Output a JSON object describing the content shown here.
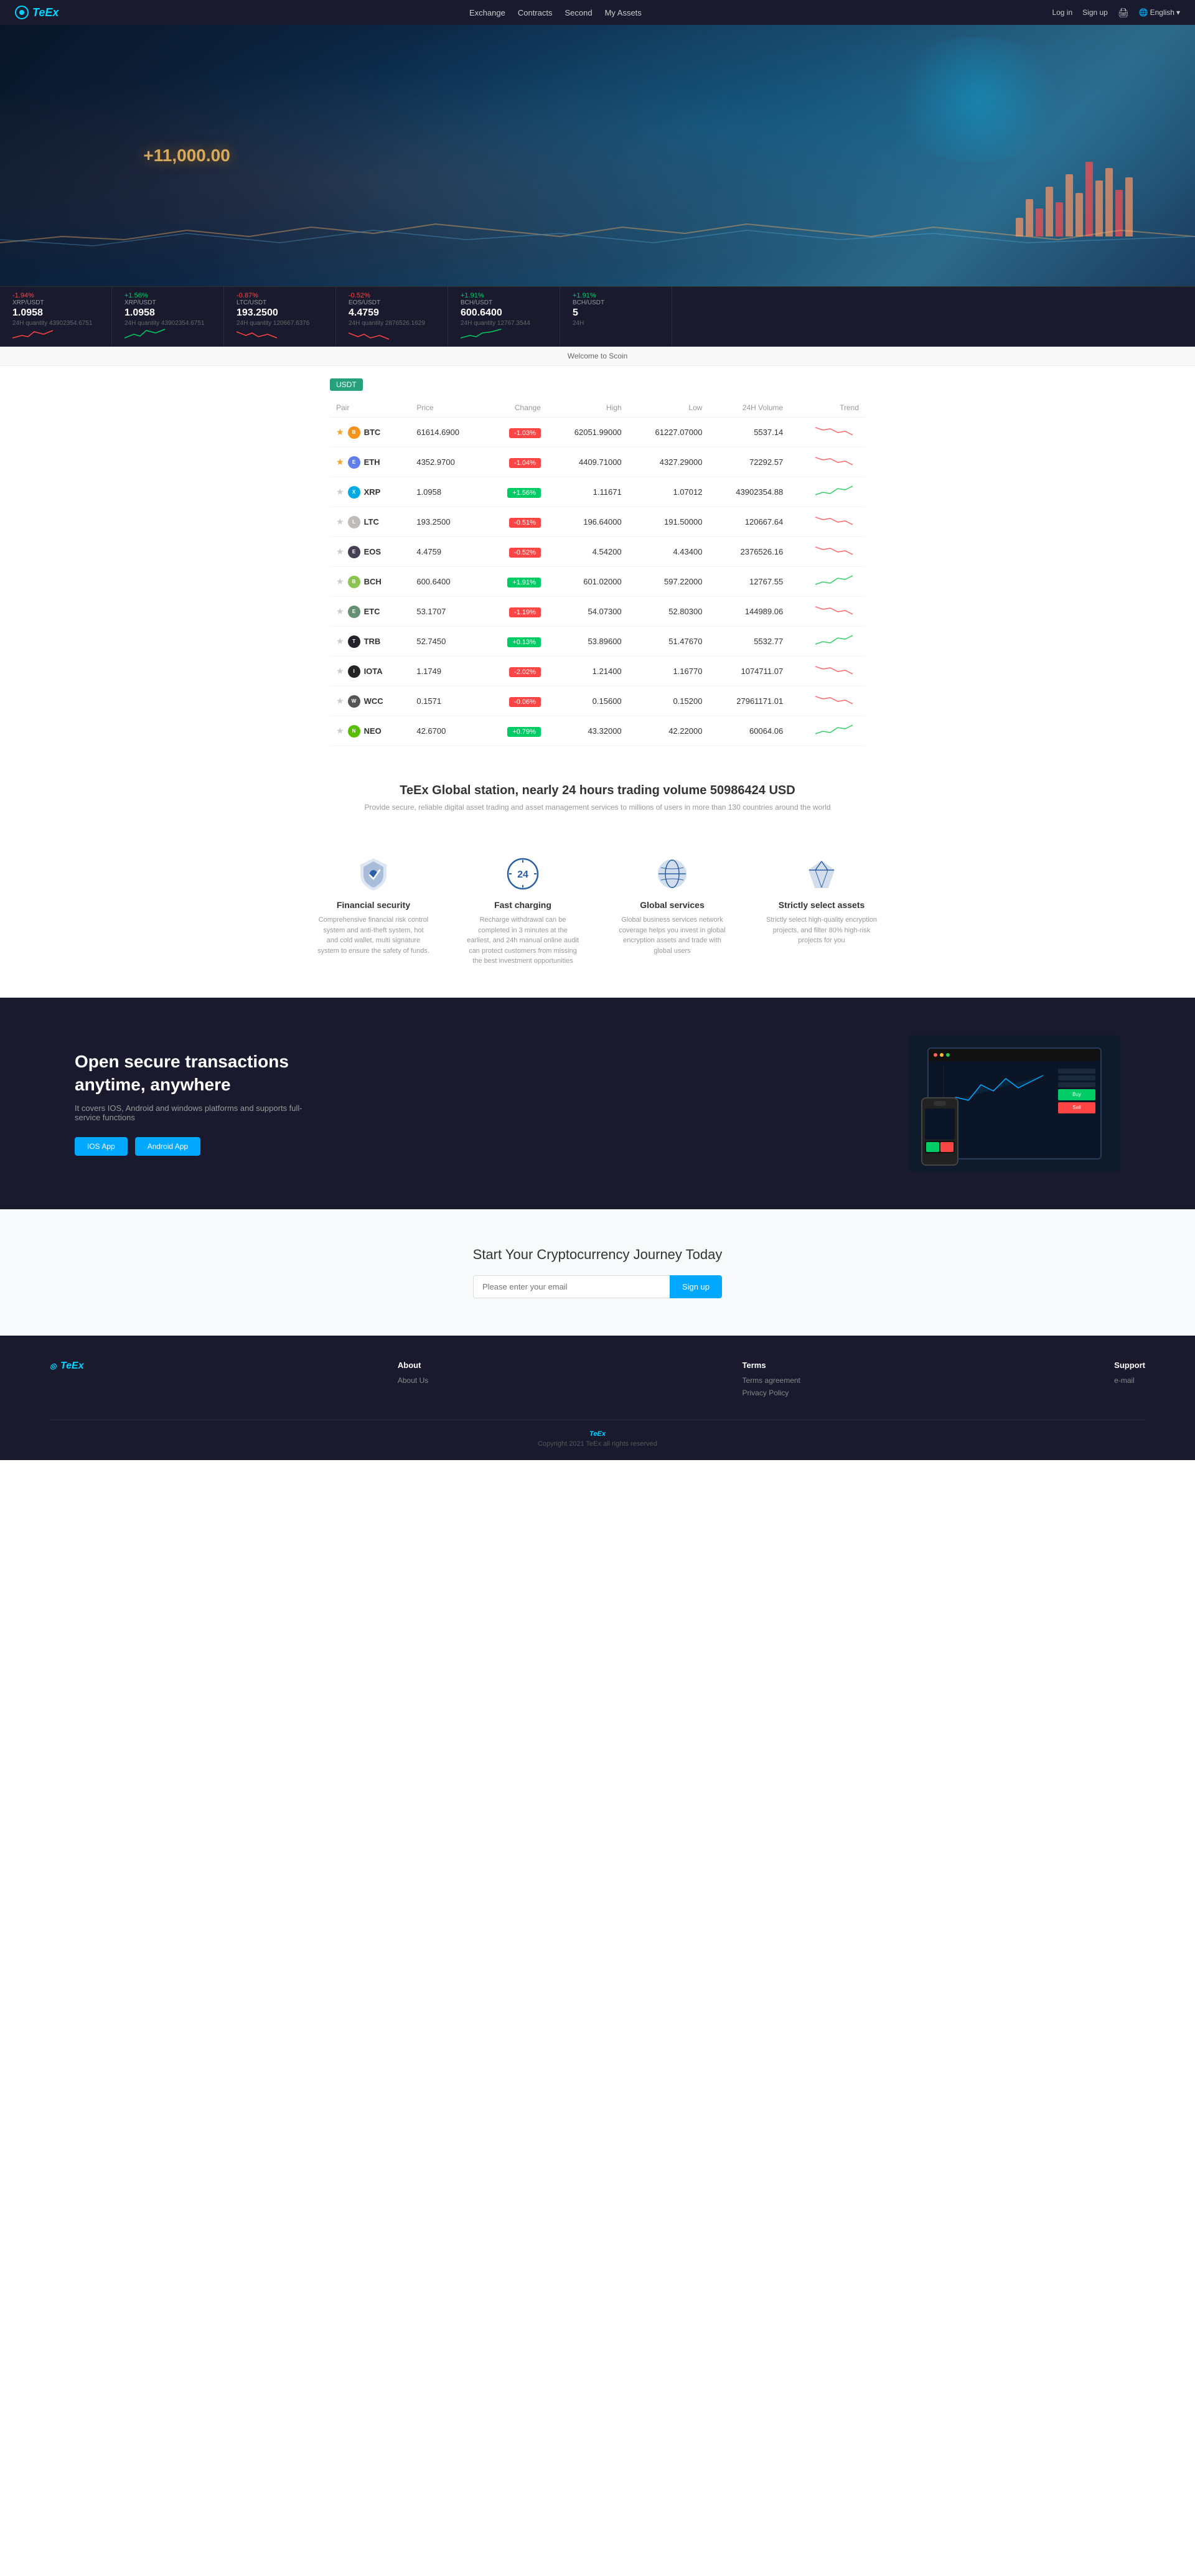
{
  "nav": {
    "logo": "TeEx",
    "links": [
      "Exchange",
      "Contracts",
      "Second",
      "My Assets"
    ],
    "login": "Log in",
    "signup": "Sign up",
    "print": "🖨",
    "language": "English"
  },
  "hero": {
    "text": "+11,000.00"
  },
  "ticker": [
    {
      "pair": "XRP/USDT",
      "change": "-1.94%",
      "price": "1.0958",
      "vol_label": "24H quantity",
      "vol": "43902354.6751",
      "neg": true
    },
    {
      "pair": "XRP/USDT",
      "change": "+1.56%",
      "price": "1.0958",
      "vol_label": "24H quantity",
      "vol": "43902354.6751",
      "neg": false
    },
    {
      "pair": "LTC/USDT",
      "change": "-0.87%",
      "price": "193.2500",
      "vol_label": "24H quantity",
      "vol": "120667.6376",
      "neg": true
    },
    {
      "pair": "EOS/USDT",
      "change": "-0.52%",
      "price": "4.4759",
      "vol_label": "24H quantity",
      "vol": "2876526.1629",
      "neg": true
    },
    {
      "pair": "BCH/USDT",
      "change": "+1.91%",
      "price": "600.6400",
      "vol_label": "24H quantity",
      "vol": "12767.3544",
      "neg": false
    }
  ],
  "welcome": "Welcome to Scoin",
  "table": {
    "tab": "USDT",
    "headers": [
      "Pair",
      "Price",
      "Change",
      "High",
      "Low",
      "24H Volume",
      "Trend"
    ],
    "rows": [
      {
        "star": true,
        "type": "BTC",
        "name": "BTC",
        "price": "61614.6900",
        "change": "-1.03%",
        "neg": true,
        "high": "62051.99000",
        "low": "61227.07000",
        "vol": "5537.14",
        "color": "#f7931a"
      },
      {
        "star": true,
        "type": "ETH",
        "name": "ETH",
        "price": "4352.9700",
        "change": "-1.04%",
        "neg": true,
        "high": "4409.71000",
        "low": "4327.29000",
        "vol": "72292.57",
        "color": "#627eea"
      },
      {
        "star": false,
        "type": "XRP",
        "name": "XRP",
        "price": "1.0958",
        "change": "+1.56%",
        "neg": false,
        "high": "1.11671",
        "low": "1.07012",
        "vol": "43902354.88",
        "color": "#00aae4"
      },
      {
        "star": false,
        "type": "LTC",
        "name": "LTC",
        "price": "193.2500",
        "change": "-0.51%",
        "neg": true,
        "high": "196.64000",
        "low": "191.50000",
        "vol": "120667.64",
        "color": "#bfbbbb"
      },
      {
        "star": false,
        "type": "EOS",
        "name": "EOS",
        "price": "4.4759",
        "change": "-0.52%",
        "neg": true,
        "high": "4.54200",
        "low": "4.43400",
        "vol": "2376526.16",
        "color": "#443f54"
      },
      {
        "star": false,
        "type": "BCH",
        "name": "BCH",
        "price": "600.6400",
        "change": "+1.91%",
        "neg": false,
        "high": "601.02000",
        "low": "597.22000",
        "vol": "12767.55",
        "color": "#8dc351"
      },
      {
        "star": false,
        "type": "ETC",
        "name": "ETC",
        "price": "53.1707",
        "change": "-1.19%",
        "neg": true,
        "high": "54.07300",
        "low": "52.80300",
        "vol": "144989.06",
        "color": "#669073"
      },
      {
        "star": false,
        "type": "TRB",
        "name": "TRB",
        "price": "52.7450",
        "change": "+0.13%",
        "neg": false,
        "high": "53.89600",
        "low": "51.47670",
        "vol": "5532.77",
        "color": "#20232a"
      },
      {
        "star": false,
        "type": "IOTA",
        "name": "IOTA",
        "price": "1.1749",
        "change": "-2.02%",
        "neg": true,
        "high": "1.21400",
        "low": "1.16770",
        "vol": "1074711.07",
        "color": "#242424"
      },
      {
        "star": false,
        "type": "WCC",
        "name": "WCC",
        "price": "0.1571",
        "change": "-0.06%",
        "neg": true,
        "high": "0.15600",
        "low": "0.15200",
        "vol": "27961171.01",
        "color": "#555"
      },
      {
        "star": false,
        "type": "NEO",
        "name": "NEO",
        "price": "42.6700",
        "change": "+0.79%",
        "neg": false,
        "high": "43.32000",
        "low": "42.22000",
        "vol": "60064.06",
        "color": "#58bf00"
      }
    ]
  },
  "stats": {
    "label": "TeEx Global station, nearly 24 hours trading volume",
    "volume": "50986424",
    "currency": "USD",
    "subtitle": "Provide secure, reliable digital asset trading and asset management services to millions of users in more than 130 countries around the world"
  },
  "features": [
    {
      "id": "financial-security",
      "title": "Financial security",
      "desc": "Comprehensive financial risk control system and anti-theft system, hot and cold wallet, multi signature system to ensure the safety of funds.",
      "icon": "shield"
    },
    {
      "id": "fast-charging",
      "title": "Fast charging",
      "desc": "Recharge withdrawal can be completed in 3 minutes at the earliest, and 24h manual online audit can protect customers from missing the best investment opportunities",
      "icon": "24"
    },
    {
      "id": "global-services",
      "title": "Global services",
      "desc": "Global business services network coverage helps you invest in global encryption assets and trade with global users",
      "icon": "globe"
    },
    {
      "id": "strictly-select",
      "title": "Strictly select assets",
      "desc": "Strictly select high-quality encryption projects, and filter 80% high-risk projects for you",
      "icon": "diamond"
    }
  ],
  "dark_section": {
    "title": "Open secure transactions anytime, anywhere",
    "desc": "It covers IOS, Android and windows platforms and supports full-service functions",
    "ios_btn": "IOS App",
    "android_btn": "Android App"
  },
  "signup_section": {
    "title": "Start Your Cryptocurrency Journey Today",
    "input_placeholder": "Please enter your email",
    "btn_label": "Sign up"
  },
  "footer": {
    "logo": "TeEx",
    "columns": [
      {
        "title": "About",
        "links": [
          "About Us"
        ]
      },
      {
        "title": "Terms",
        "links": [
          "Terms agreement",
          "Privacy Policy"
        ]
      },
      {
        "title": "Support",
        "links": [
          "e-mail"
        ]
      }
    ],
    "copyright": "Copyright 2021 TeEx all rights reserved",
    "bottom_name": "TeEx"
  }
}
